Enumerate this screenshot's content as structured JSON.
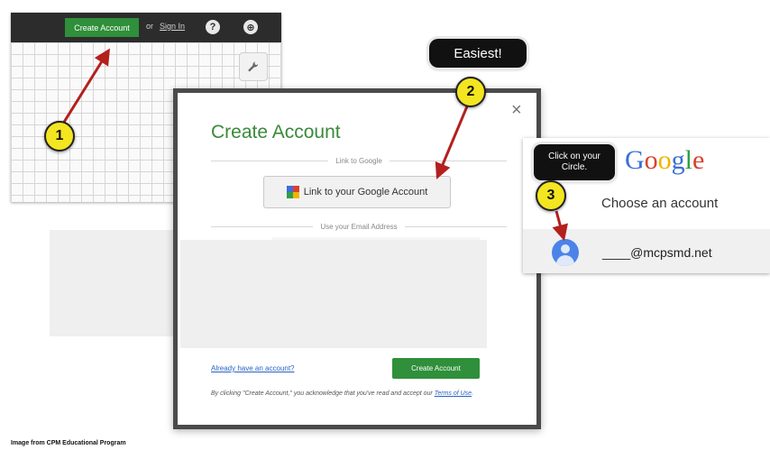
{
  "app": {
    "create_account_label": "Create Account",
    "or_text": "or",
    "sign_in_label": "Sign In",
    "help_icon_glyph": "?",
    "globe_icon_glyph": "⊕",
    "wrench_icon_glyph": "🔧"
  },
  "dialog": {
    "title": "Create Account",
    "close_glyph": "×",
    "link_section_label": "Link to Google",
    "google_link_label": "Link to your Google Account",
    "email_section_label": "Use your Email Address",
    "already_link_label": "Already have an account?",
    "create_button_label": "Create Account",
    "terms_prefix": "By clicking \"Create Account,\" you acknowledge that you've read and accept our ",
    "terms_link": "Terms of Use",
    "terms_suffix": "."
  },
  "google": {
    "logo_letters": [
      "G",
      "o",
      "o",
      "g",
      "l",
      "e"
    ],
    "choose_text": "Choose an account",
    "account_email": "____@mcpsmd.net"
  },
  "callouts": {
    "easiest": "Easiest!",
    "circle_line1": "Click on your",
    "circle_line2": "Circle.",
    "badges": [
      "1",
      "2",
      "3"
    ]
  },
  "caption": "Image from CPM Educational Program",
  "colors": {
    "green": "#2f8f3a",
    "badge_yellow": "#f3e520",
    "arrow_red": "#b3201d",
    "link_blue": "#2a62c4"
  }
}
